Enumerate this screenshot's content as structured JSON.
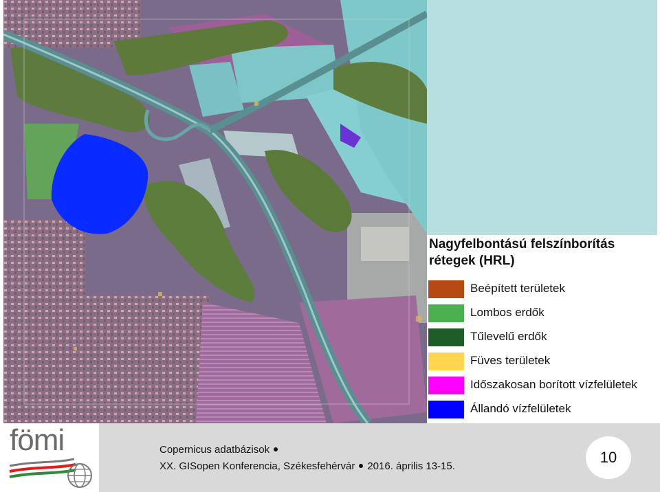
{
  "legend": {
    "title": "Nagyfelbontású felszínborítás rétegek (HRL)",
    "items": [
      {
        "label": "Beépített területek",
        "color": "#b54a12"
      },
      {
        "label": "Lombos erdők",
        "color": "#4caf50"
      },
      {
        "label": "Tűlevelű erdők",
        "color": "#1e5c2a"
      },
      {
        "label": "Füves területek",
        "color": "#ffd54f"
      },
      {
        "label": "Időszakosan borított vízfelületek",
        "color": "#ff00ff"
      },
      {
        "label": "Állandó vízfelületek",
        "color": "#0000ff"
      }
    ]
  },
  "footer": {
    "line1": "Copernicus adatbázisok",
    "line2_part1": "XX. GISopen Konferencia, Székesfehérvár",
    "line2_part2": "2016. április 13-15.",
    "page_number": "10"
  },
  "logo": {
    "text": "fömi"
  },
  "colors": {
    "map_background": "#5b6e6a",
    "panel_teal": "#b7dfe0",
    "footer_bg": "#d9d9d9"
  }
}
